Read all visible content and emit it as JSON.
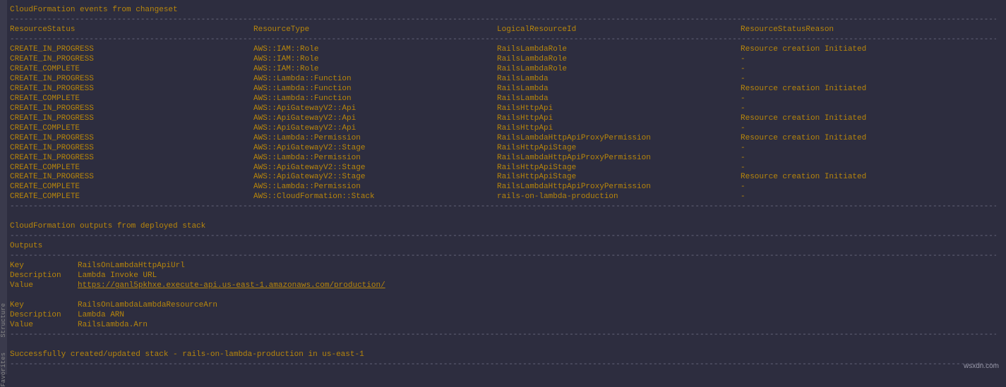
{
  "title_events": "CloudFormation events from changeset",
  "headers": {
    "status": "ResourceStatus",
    "type": "ResourceType",
    "id": "LogicalResourceId",
    "reason": "ResourceStatusReason"
  },
  "rows": [
    {
      "status": "CREATE_IN_PROGRESS",
      "type": "AWS::IAM::Role",
      "id": "RailsLambdaRole",
      "reason": "Resource creation Initiated"
    },
    {
      "status": "CREATE_IN_PROGRESS",
      "type": "AWS::IAM::Role",
      "id": "RailsLambdaRole",
      "reason": "-"
    },
    {
      "status": "CREATE_COMPLETE",
      "type": "AWS::IAM::Role",
      "id": "RailsLambdaRole",
      "reason": "-"
    },
    {
      "status": "CREATE_IN_PROGRESS",
      "type": "AWS::Lambda::Function",
      "id": "RailsLambda",
      "reason": "-"
    },
    {
      "status": "CREATE_IN_PROGRESS",
      "type": "AWS::Lambda::Function",
      "id": "RailsLambda",
      "reason": "Resource creation Initiated"
    },
    {
      "status": "CREATE_COMPLETE",
      "type": "AWS::Lambda::Function",
      "id": "RailsLambda",
      "reason": "-"
    },
    {
      "status": "CREATE_IN_PROGRESS",
      "type": "AWS::ApiGatewayV2::Api",
      "id": "RailsHttpApi",
      "reason": "-"
    },
    {
      "status": "CREATE_IN_PROGRESS",
      "type": "AWS::ApiGatewayV2::Api",
      "id": "RailsHttpApi",
      "reason": "Resource creation Initiated"
    },
    {
      "status": "CREATE_COMPLETE",
      "type": "AWS::ApiGatewayV2::Api",
      "id": "RailsHttpApi",
      "reason": "-"
    },
    {
      "status": "CREATE_IN_PROGRESS",
      "type": "AWS::Lambda::Permission",
      "id": "RailsLambdaHttpApiProxyPermission",
      "reason": "Resource creation Initiated"
    },
    {
      "status": "CREATE_IN_PROGRESS",
      "type": "AWS::ApiGatewayV2::Stage",
      "id": "RailsHttpApiStage",
      "reason": "-"
    },
    {
      "status": "CREATE_IN_PROGRESS",
      "type": "AWS::Lambda::Permission",
      "id": "RailsLambdaHttpApiProxyPermission",
      "reason": "-"
    },
    {
      "status": "CREATE_COMPLETE",
      "type": "AWS::ApiGatewayV2::Stage",
      "id": "RailsHttpApiStage",
      "reason": "-"
    },
    {
      "status": "CREATE_IN_PROGRESS",
      "type": "AWS::ApiGatewayV2::Stage",
      "id": "RailsHttpApiStage",
      "reason": "Resource creation Initiated"
    },
    {
      "status": "CREATE_COMPLETE",
      "type": "AWS::Lambda::Permission",
      "id": "RailsLambdaHttpApiProxyPermission",
      "reason": "-"
    },
    {
      "status": "CREATE_COMPLETE",
      "type": "AWS::CloudFormation::Stack",
      "id": "rails-on-lambda-production",
      "reason": "-"
    }
  ],
  "title_outputs": "CloudFormation outputs from deployed stack",
  "outputs_header": "Outputs",
  "outputs": [
    {
      "key_label": "Key",
      "key": "RailsOnLambdaHttpApiUrl",
      "desc_label": "Description",
      "desc": "Lambda Invoke URL",
      "value_label": "Value",
      "value": "https://ganl5pkhxe.execute-api.us-east-1.amazonaws.com/production/",
      "is_link": true
    },
    {
      "key_label": "Key",
      "key": "RailsOnLambdaLambdaResourceArn",
      "desc_label": "Description",
      "desc": "Lambda ARN",
      "value_label": "Value",
      "value": "RailsLambda.Arn",
      "is_link": false
    }
  ],
  "success_msg": "Successfully created/updated stack - rails-on-lambda-production in us-east-1",
  "dash_line": "-----------------------------------------------------------------------------------------------------------------------------------------------------------------------------------------------------------------------------------------------------------",
  "sidebar": {
    "structure": "Structure",
    "favorites": "Favorites"
  },
  "watermark": "wsxdn.com"
}
